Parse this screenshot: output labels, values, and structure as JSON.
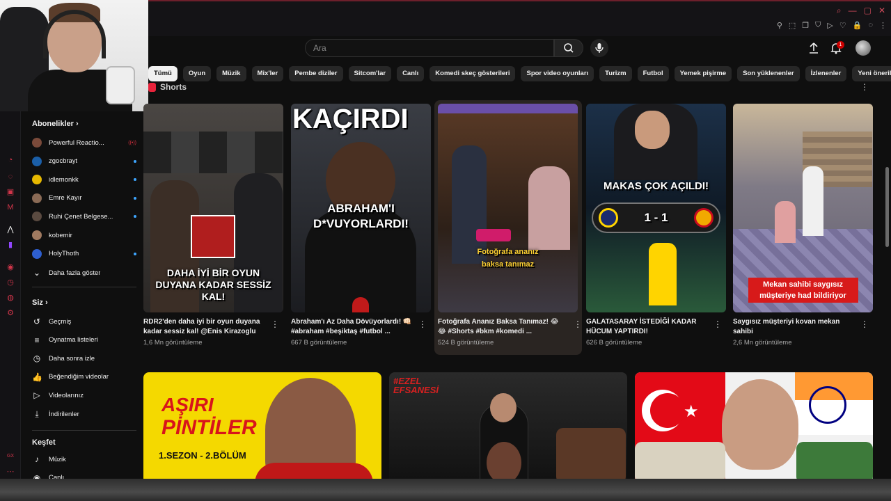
{
  "header": {
    "search_placeholder": "Ara",
    "notification_count": "1"
  },
  "chips": [
    "Tümü",
    "Oyun",
    "Müzik",
    "Mix'ler",
    "Pembe diziler",
    "Sitcom'lar",
    "Canlı",
    "Komedi skeç gösterileri",
    "Spor video oyunları",
    "Turizm",
    "Futbol",
    "Yemek pişirme",
    "Son yüklenenler",
    "İzlenenler",
    "Yeni öneriler"
  ],
  "sidebar": {
    "subscriptions_title": "Abonelikler",
    "subscriptions": [
      {
        "label": "Powerful Reactio...",
        "color": "#7a4a3a",
        "status": "live"
      },
      {
        "label": "zgocbrayt",
        "color": "#1b5fa8",
        "status": "dot"
      },
      {
        "label": "idlemonkk",
        "color": "#e6b800",
        "status": "dot"
      },
      {
        "label": "Emre Kayır",
        "color": "#8a6a55",
        "status": "dot"
      },
      {
        "label": "Ruhi Çenet Belgese...",
        "color": "#5a4a40",
        "status": "dot"
      },
      {
        "label": "kobemir",
        "color": "#a07a60",
        "status": ""
      },
      {
        "label": "HolyThoth",
        "color": "#2e5fcf",
        "status": "dot"
      }
    ],
    "show_more": "Daha fazla göster",
    "you_title": "Siz",
    "you_items": [
      {
        "label": "Geçmiş",
        "icon": "history-icon",
        "glyph": "↺"
      },
      {
        "label": "Oynatma listeleri",
        "icon": "playlist-icon",
        "glyph": "≡"
      },
      {
        "label": "Daha sonra izle",
        "icon": "clock-icon",
        "glyph": "◷"
      },
      {
        "label": "Beğendiğim videolar",
        "icon": "thumbs-up-icon",
        "glyph": "👍"
      },
      {
        "label": "Videolarınız",
        "icon": "video-icon",
        "glyph": "▷"
      },
      {
        "label": "İndirilenler",
        "icon": "download-icon",
        "glyph": "⤓"
      }
    ],
    "explore_title": "Keşfet",
    "explore_items": [
      {
        "label": "Müzik",
        "icon": "music-icon",
        "glyph": "♪"
      },
      {
        "label": "Canlı",
        "icon": "live-icon",
        "glyph": "◉"
      }
    ]
  },
  "shorts": {
    "heading": "Shorts",
    "items": [
      {
        "title": "RDR2'den daha iyi bir oyun duyana kadar sessiz kal! @Enis Kirazoglu",
        "views": "1,6 Mn görüntüleme",
        "overlay": "DAHA İYİ BİR OYUN DUYANA KADAR SESSİZ KAL!",
        "bg": "#3a3633"
      },
      {
        "title": "Abraham'ı Az Daha Dövüyorlardı! 👊🏻 #abraham #beşiktaş #futbol ...",
        "views": "667 B görüntüleme",
        "overlay": "ABRAHAM'I D*VUYORLARDI!",
        "top_text": "KAÇIRDI",
        "bg": "#2c2f36"
      },
      {
        "title": "Fotoğrafa Ananız Baksa Tanımaz! 😂😂 #Shorts #bkm #komedi ...",
        "views": "524 B görüntüleme",
        "overlay": "Fotoğrafa ananız baksa tanımaz",
        "bg": "#3b2a22"
      },
      {
        "title": "GALATASARAY İSTEDİĞİ KADAR HÜCUM YAPTIRDI!",
        "views": "626 B görüntüleme",
        "overlay": "MAKAS ÇOK AÇILDI!",
        "score": "1 - 1",
        "bg": "#1f3a4a"
      },
      {
        "title": "Saygısız müşteriyi kovan mekan sahibi",
        "views": "2,6 Mn görüntüleme",
        "overlay": "Mekan sahibi saygısız müşteriye had bildiriyor",
        "bg": "#6a6874"
      }
    ]
  },
  "videos": [
    {
      "title_line1": "AŞIRI",
      "title_line2": "PİNTİLER",
      "subtitle": "1.SEZON - 2.BÖLÜM"
    },
    {
      "tag": "#EZEL EFSANESİ"
    },
    {
      "flags": "TR-IN"
    }
  ]
}
